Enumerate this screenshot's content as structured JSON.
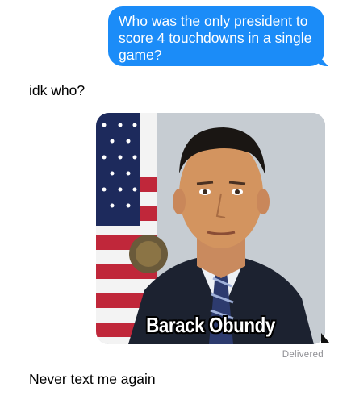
{
  "messages": {
    "outgoing_1": "Who was the only president to score 4 touchdowns in a single game?",
    "incoming_1": "idk who?",
    "image_caption": "Barack Obundy",
    "status": "Delivered",
    "incoming_2": "Never text me again"
  },
  "colors": {
    "outgoing_bubble": "#1b8cf8",
    "background": "#ffffff",
    "status_text": "#8e8e93"
  }
}
